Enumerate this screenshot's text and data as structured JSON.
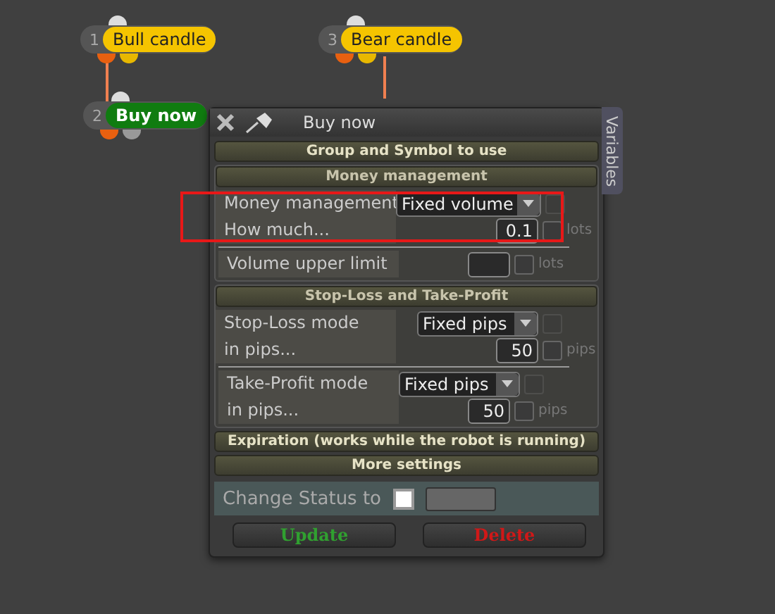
{
  "nodes": [
    {
      "number": "1",
      "label": "Bull candle",
      "kind": "condition",
      "color": "#f5c400"
    },
    {
      "number": "3",
      "label": "Bear candle",
      "kind": "condition",
      "color": "#f5c400"
    },
    {
      "number": "2",
      "label": "Buy now",
      "kind": "action",
      "color": "#107c10"
    }
  ],
  "dialog": {
    "title": "Buy now",
    "side_tab": "Variables",
    "sections": [
      {
        "title": "Group and Symbol to use",
        "expanded": false
      },
      {
        "title": "Money management",
        "expanded": true,
        "groups": [
          [
            {
              "kind": "select",
              "label": "Money management",
              "value": "Fixed volume",
              "checked": false
            },
            {
              "kind": "number",
              "label": "How much...",
              "value": "0.1",
              "unit": "lots",
              "checked": false
            }
          ],
          [
            {
              "kind": "number",
              "label": "Volume upper limit",
              "unit": "lots",
              "checked": false
            }
          ]
        ]
      },
      {
        "title": "Stop-Loss and Take-Profit",
        "expanded": true,
        "groups": [
          [
            {
              "kind": "select",
              "label": "Stop-Loss mode",
              "value": "Fixed pips",
              "checked": false
            },
            {
              "kind": "number",
              "label": "in pips...",
              "value": "50",
              "unit": "pips",
              "checked": false
            }
          ],
          [
            {
              "kind": "select",
              "label": "Take-Profit mode",
              "value": "Fixed pips",
              "checked": false
            },
            {
              "kind": "number",
              "label": "in pips...",
              "value": "50",
              "unit": "pips",
              "checked": false
            }
          ]
        ]
      },
      {
        "title": "Expiration (works while the robot is running)",
        "expanded": false
      },
      {
        "title": "More settings",
        "expanded": false
      }
    ],
    "status": {
      "label": "Change Status to",
      "checked": false
    },
    "buttons": [
      {
        "label": "Update",
        "kind": "confirm"
      },
      {
        "label": "Delete",
        "kind": "danger"
      }
    ]
  }
}
